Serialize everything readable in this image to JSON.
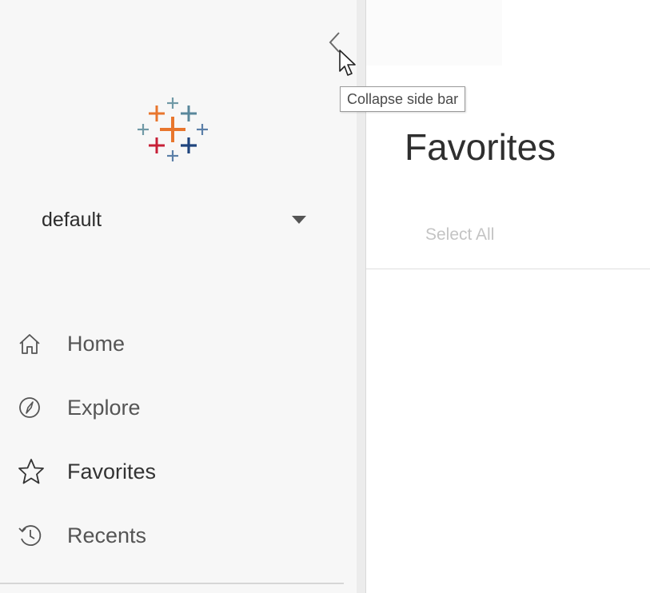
{
  "tooltip": {
    "text": "Collapse side bar"
  },
  "site": {
    "selected": "default"
  },
  "nav": {
    "items": [
      {
        "label": "Home",
        "icon": "home-icon"
      },
      {
        "label": "Explore",
        "icon": "compass-icon"
      },
      {
        "label": "Favorites",
        "icon": "star-icon"
      },
      {
        "label": "Recents",
        "icon": "history-icon"
      }
    ]
  },
  "main": {
    "title": "Favorites",
    "select_all": "Select All"
  },
  "colors": {
    "logo_orange": "#e8762d",
    "logo_red": "#c72037",
    "logo_blue": "#5b7fa8",
    "logo_navy": "#1f457e",
    "logo_light_blue": "#7099a6",
    "logo_teal": "#59879b"
  }
}
